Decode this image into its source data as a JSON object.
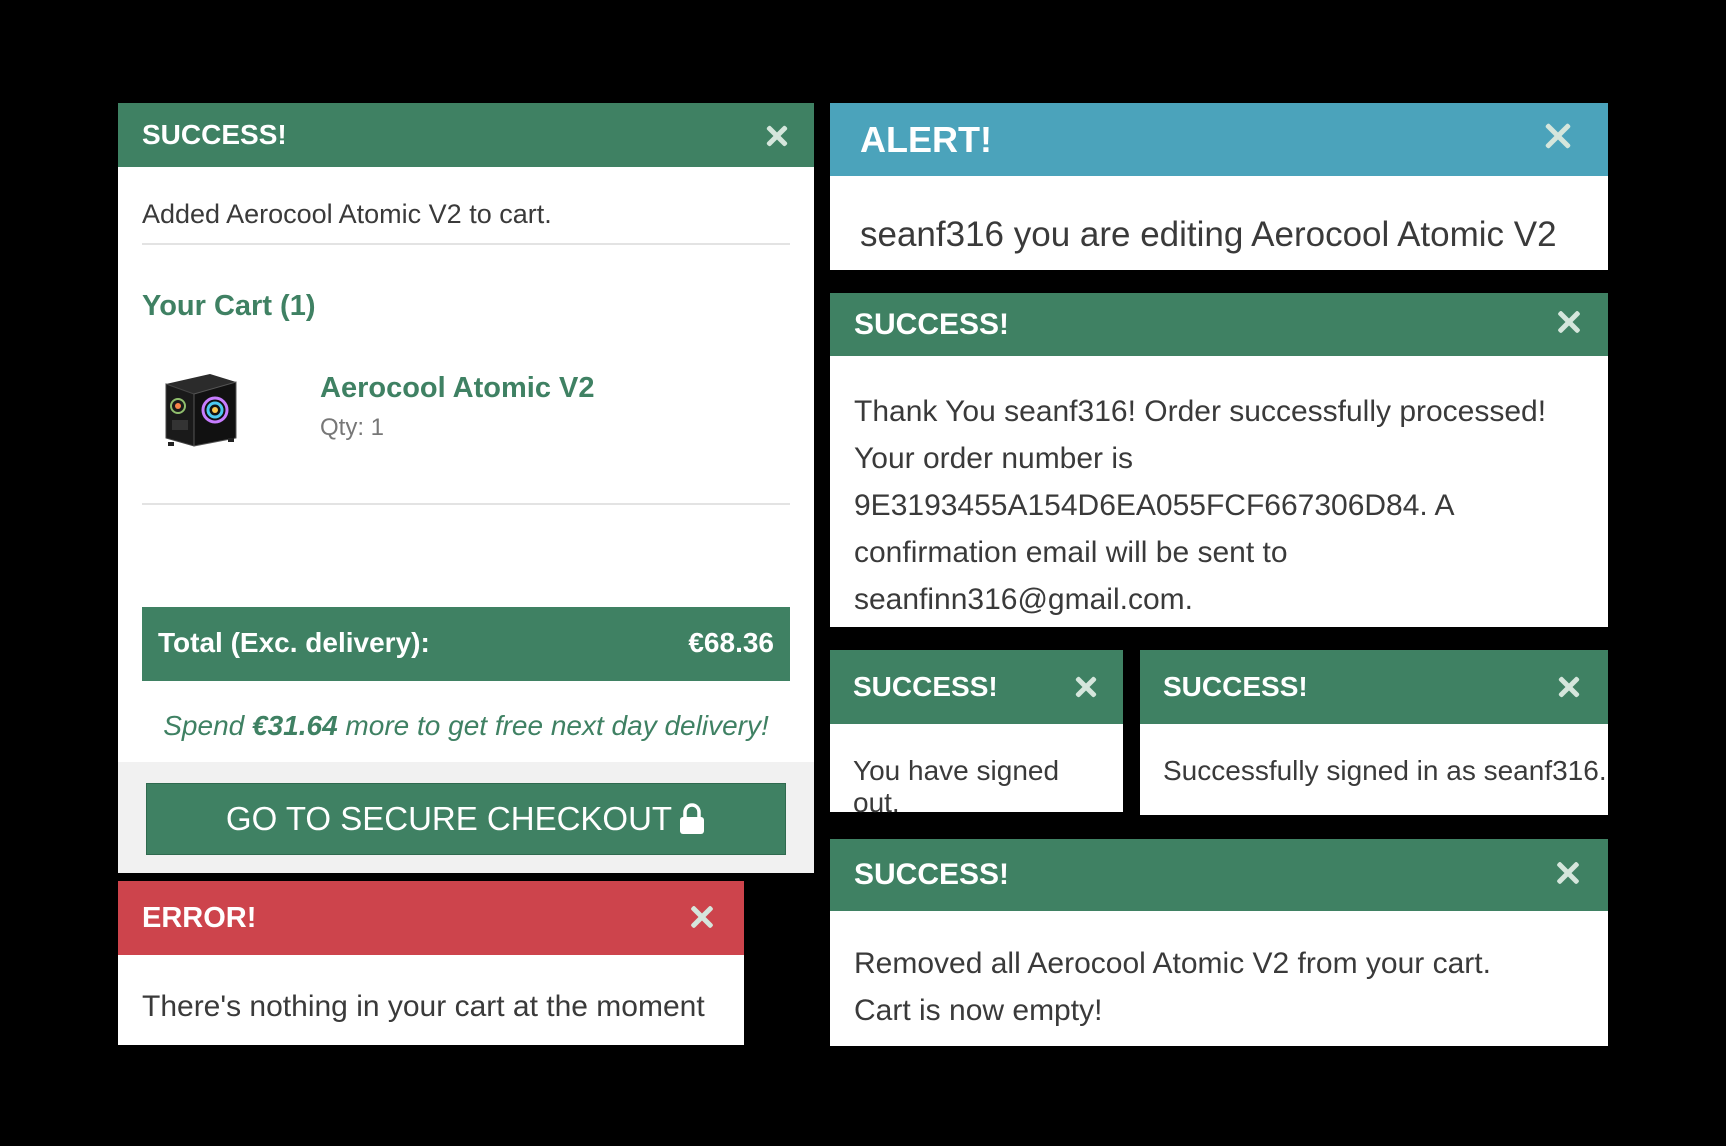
{
  "cart_toast": {
    "title": "SUCCESS!",
    "message": "Added Aerocool Atomic V2 to cart.",
    "cart_heading": "Your Cart (1)",
    "item": {
      "name": "Aerocool Atomic V2",
      "qty": "Qty: 1"
    },
    "total_label": "Total (Exc. delivery):",
    "total_value": "€68.36",
    "promo_prefix": "Spend ",
    "promo_amount": "€31.64",
    "promo_suffix": " more to get free next day delivery!",
    "checkout_label": "GO TO SECURE CHECKOUT"
  },
  "error_toast": {
    "title": "ERROR!",
    "message": "There's nothing in your cart at the moment"
  },
  "alert_toast": {
    "title": "ALERT!",
    "message": "seanf316 you are editing Aerocool Atomic V2"
  },
  "order_toast": {
    "title": "SUCCESS!",
    "lines": [
      "Thank You seanf316! Order successfully processed!",
      "Your order number is",
      "9E3193455A154D6EA055FCF667306D84. A",
      "confirmation email will be sent to",
      "seanfinn316@gmail.com."
    ]
  },
  "signout_toast": {
    "title": "SUCCESS!",
    "message": "You have signed out."
  },
  "signin_toast": {
    "title": "SUCCESS!",
    "message": "Successfully signed in as seanf316."
  },
  "removed_toast": {
    "title": "SUCCESS!",
    "lines": [
      "Removed all Aerocool Atomic V2 from your cart.",
      "Cart is now empty!"
    ]
  },
  "colors": {
    "success": "#3f8163",
    "alert": "#4ba3bb",
    "error": "#cd444c",
    "background": "#000000"
  },
  "icons": [
    "close-icon",
    "lock-icon",
    "pc-case-image"
  ]
}
